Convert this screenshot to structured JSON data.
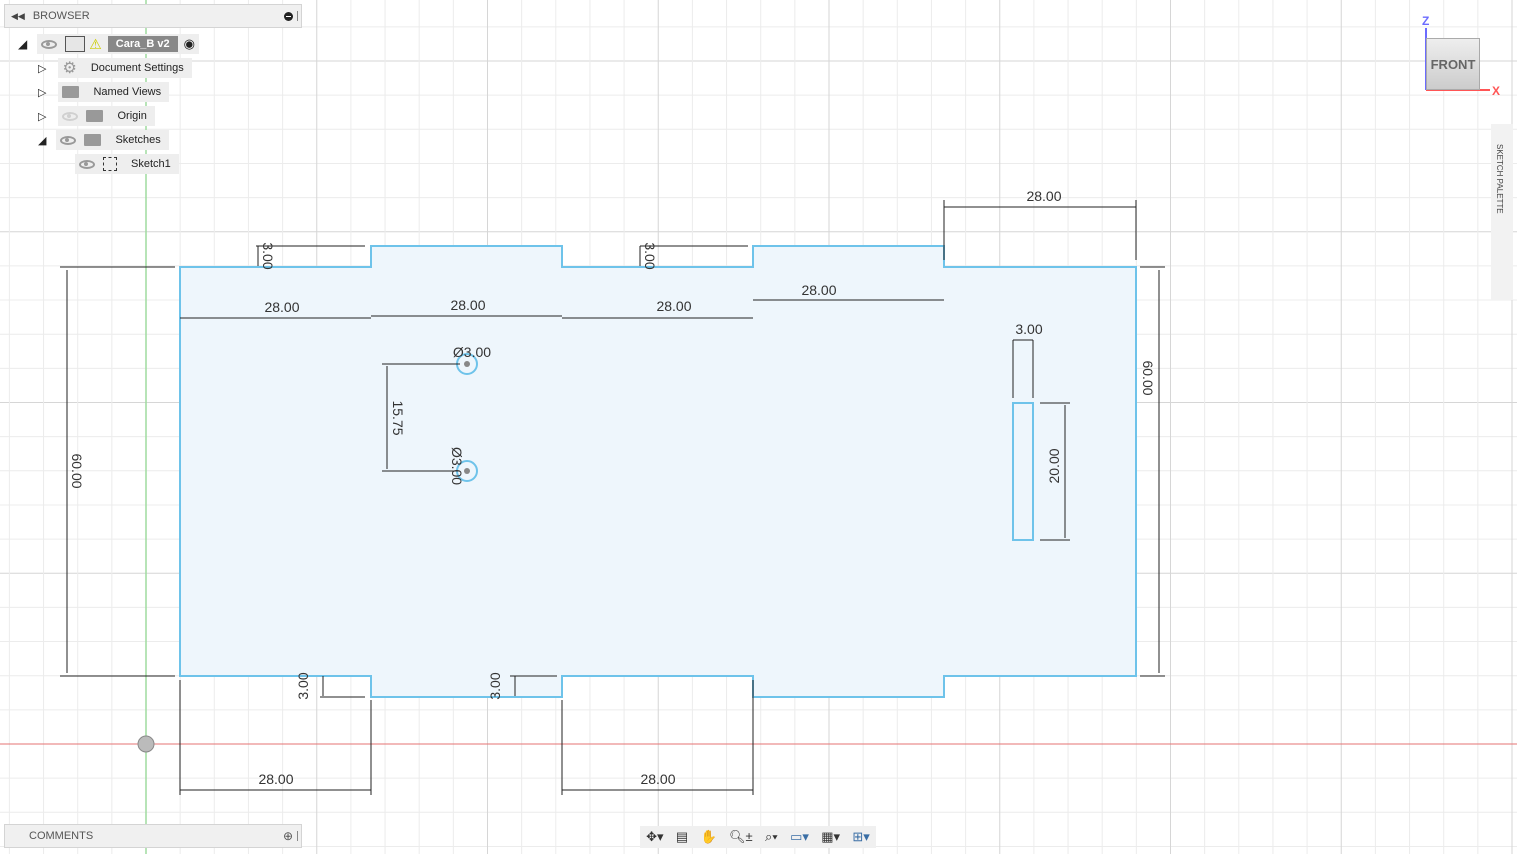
{
  "browser": {
    "title": "BROWSER",
    "root": "Cara_B v2",
    "items": [
      {
        "label": "Document Settings"
      },
      {
        "label": "Named Views"
      },
      {
        "label": "Origin"
      },
      {
        "label": "Sketches"
      },
      {
        "label": "Sketch1"
      }
    ]
  },
  "comments": {
    "title": "COMMENTS"
  },
  "viewcube": {
    "face": "FRONT",
    "x": "X",
    "z": "Z"
  },
  "palette": {
    "title": "SKETCH PALETTE"
  },
  "dims": {
    "top_left_tab_depth": "3.00",
    "top_mid_tab_depth": "3.00",
    "w1": "28.00",
    "w2": "28.00",
    "w3": "28.00",
    "w4": "28.00",
    "w5": "28.00",
    "height_left": "60.00",
    "height_right": "60.00",
    "hole_top": "Ø3.00",
    "hole_bottom": "Ø3.00",
    "hole_spacing": "15.75",
    "slot_width": "3.00",
    "slot_height": "20.00",
    "bot_tab_depth1": "3.00",
    "bot_tab_depth2": "3.00",
    "bot_w1": "28.00",
    "bot_w2": "28.00"
  },
  "toolbar": {
    "icons": [
      "orbit-icon",
      "look-at-icon",
      "pan-icon",
      "zoom-icon",
      "fit-icon",
      "display-icon",
      "grid-icon",
      "viewports-icon"
    ]
  }
}
